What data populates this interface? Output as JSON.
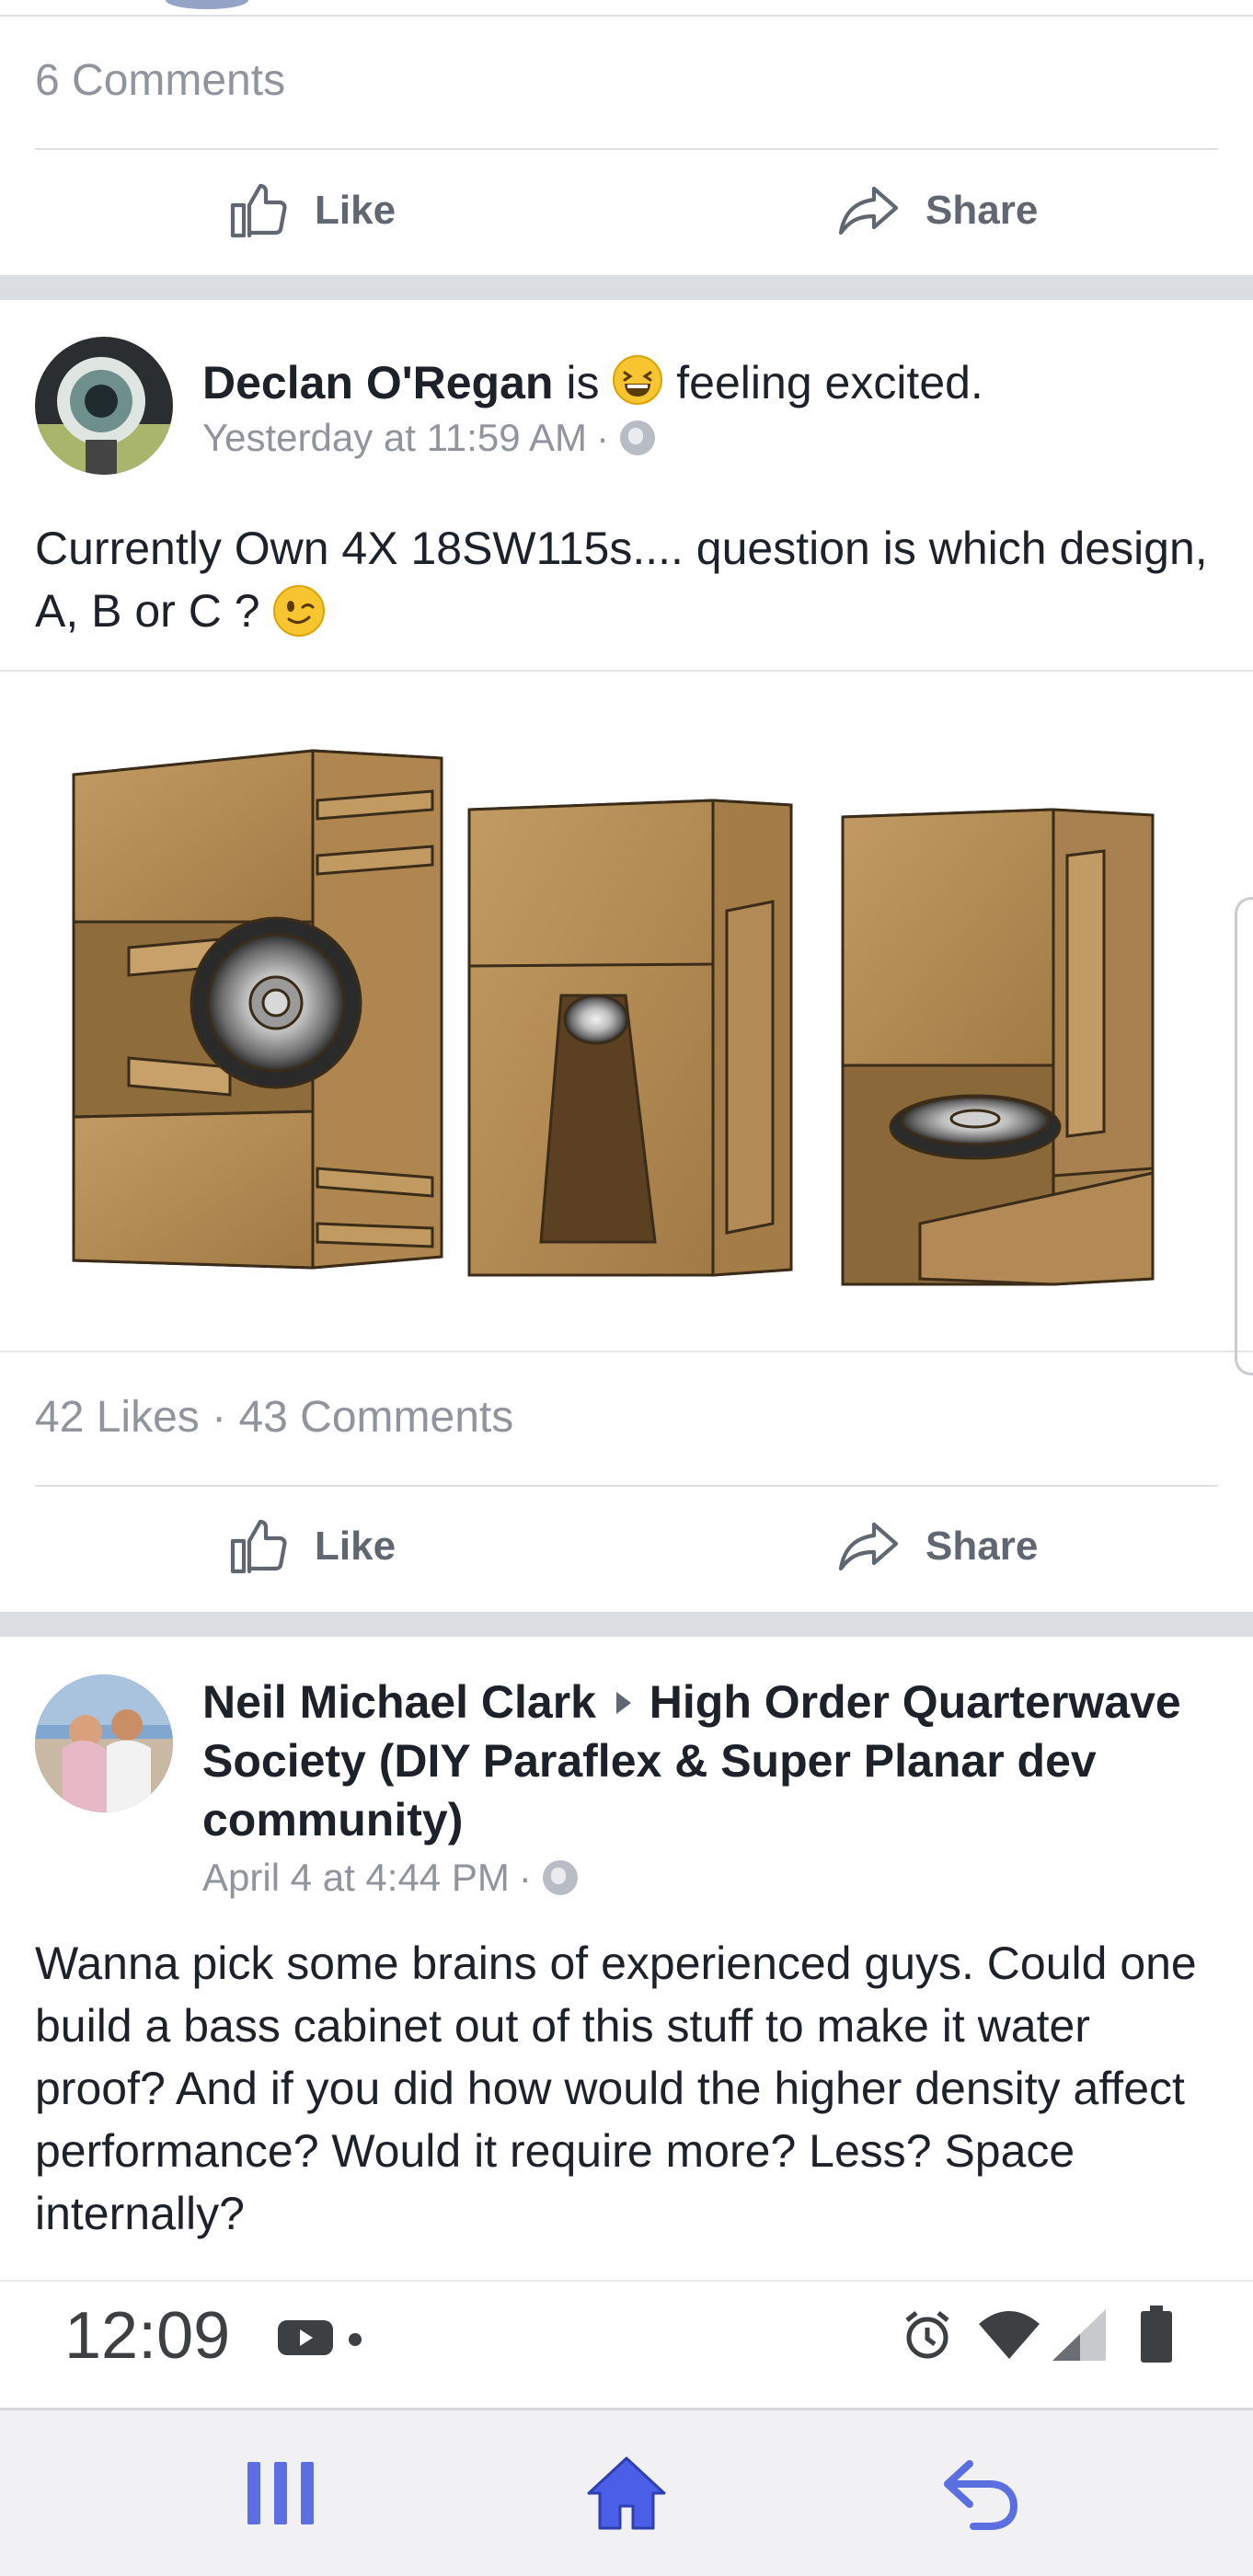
{
  "previous_post": {
    "counts": "6 Comments",
    "like_label": "Like",
    "share_label": "Share"
  },
  "post1": {
    "author": "Declan O'Regan",
    "verb": "is",
    "activity": "feeling excited.",
    "time": "Yesterday at 11:59 AM",
    "meta_sep": "·",
    "text": "Currently Own 4X 18SW115s.... question is which design, A, B or C ?",
    "counts": "42 Likes · 43 Comments",
    "like_label": "Like",
    "share_label": "Share"
  },
  "post2": {
    "author": "Neil Michael Clark",
    "group": "High Order Quarterwave Society (DIY Paraflex & Super Planar dev community)",
    "time": "April 4 at 4:44 PM",
    "meta_sep": "·",
    "text": "Wanna pick some brains of experienced guys. Could one build a bass cabinet out of this stuff to make it water proof? And if you did how would the higher density affect performance? Would it require more? Less? Space internally?"
  },
  "status_bar": {
    "time": "12:09"
  },
  "nav": {
    "icons": [
      "recent-apps-icon",
      "home-icon",
      "back-icon"
    ],
    "accent": "#4a5ee8"
  },
  "colors": {
    "text": "#1d2129",
    "muted": "#90949c",
    "action": "#606770",
    "separator": "#dadde1",
    "wood": "#b38a55"
  }
}
